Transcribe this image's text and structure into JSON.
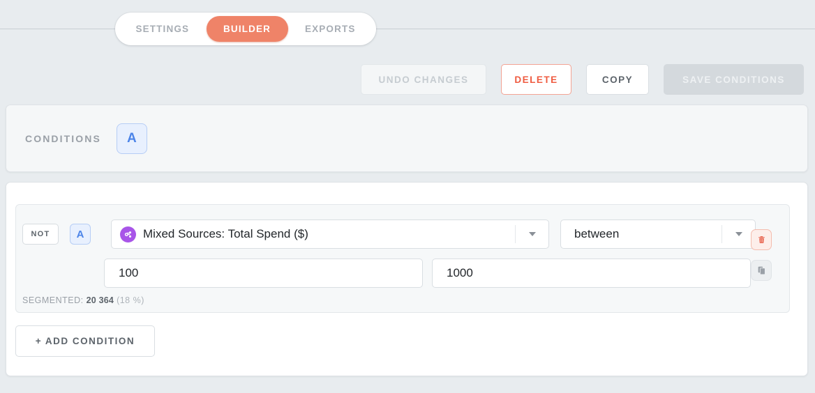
{
  "tabs": [
    {
      "label": "SETTINGS",
      "active": false
    },
    {
      "label": "BUILDER",
      "active": true
    },
    {
      "label": "EXPORTS",
      "active": false
    }
  ],
  "toolbar": {
    "undo_label": "UNDO CHANGES",
    "delete_label": "DELETE",
    "copy_label": "COPY",
    "save_label": "SAVE CONDITIONS"
  },
  "conditions_panel": {
    "title": "CONDITIONS",
    "group_badge": "A"
  },
  "condition": {
    "not_label": "NOT",
    "group_badge": "A",
    "field_icon": "mixed-sources-icon",
    "field_value": "Mixed Sources: Total Spend ($)",
    "operator_value": "between",
    "value_from": "100",
    "value_to": "1000",
    "segmented_label": "SEGMENTED:",
    "segmented_count": "20 364",
    "segmented_percent": "(18 %)",
    "delete_icon": "trash-icon",
    "duplicate_icon": "copy-icon"
  },
  "add_condition": {
    "label": "+ ADD CONDITION"
  },
  "colors": {
    "accent": "#ef8368",
    "badge_blue": "#4c84e8",
    "source_purple": "#a855e8",
    "danger": "#ef5b40",
    "page_bg": "#e8ecef"
  }
}
